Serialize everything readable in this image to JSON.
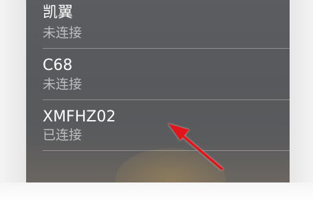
{
  "devices": [
    {
      "name": "凯翼",
      "status": "未连接"
    },
    {
      "name": "C68",
      "status": "未连接"
    },
    {
      "name": "XMFHZ02",
      "status": "已连接"
    }
  ],
  "annotation": {
    "color": "#e0191c"
  }
}
